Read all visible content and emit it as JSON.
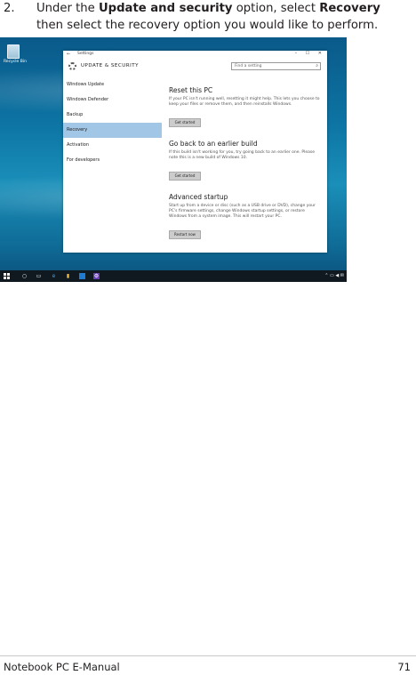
{
  "step": {
    "number": "2.",
    "part1": "Under the ",
    "bold1": "Update and security",
    "part2": " option, select ",
    "bold2": "Recovery",
    "part3": " then select the recovery option you would like to perform."
  },
  "screenshot": {
    "desktop_icon_label": "Recycle Bin",
    "window": {
      "title": "Settings",
      "controls": "– ☐ ✕",
      "header_title": "UPDATE & SECURITY",
      "search_placeholder": "Find a setting",
      "nav": [
        "Windows Update",
        "Windows Defender",
        "Backup",
        "Recovery",
        "Activation",
        "For developers"
      ],
      "active_nav": "Recovery",
      "sections": [
        {
          "heading": "Reset this PC",
          "text": "If your PC isn't running well, resetting it might help. This lets you choose to keep your files or remove them, and then reinstalls Windows.",
          "button": "Get started"
        },
        {
          "heading": "Go back to an earlier build",
          "text": "If this build isn't working for you, try going back to an earlier one. Please note this is a new build of Windows 10.",
          "button": "Get started"
        },
        {
          "heading": "Advanced startup",
          "text": "Start up from a device or disc (such as a USB drive or DVD), change your PC's firmware settings, change Windows startup settings, or restore Windows from a system image. This will restart your PC.",
          "button": "Restart now"
        }
      ]
    },
    "taskbar": {
      "tray": "⌃ ▭ ◀ ✉"
    }
  },
  "footer": {
    "title": "Notebook PC E-Manual",
    "page": "71"
  },
  "colors": {
    "accent_nav": "#a2c6e6",
    "desktop_bg": "#0d74a3",
    "taskbar": "#101820"
  }
}
